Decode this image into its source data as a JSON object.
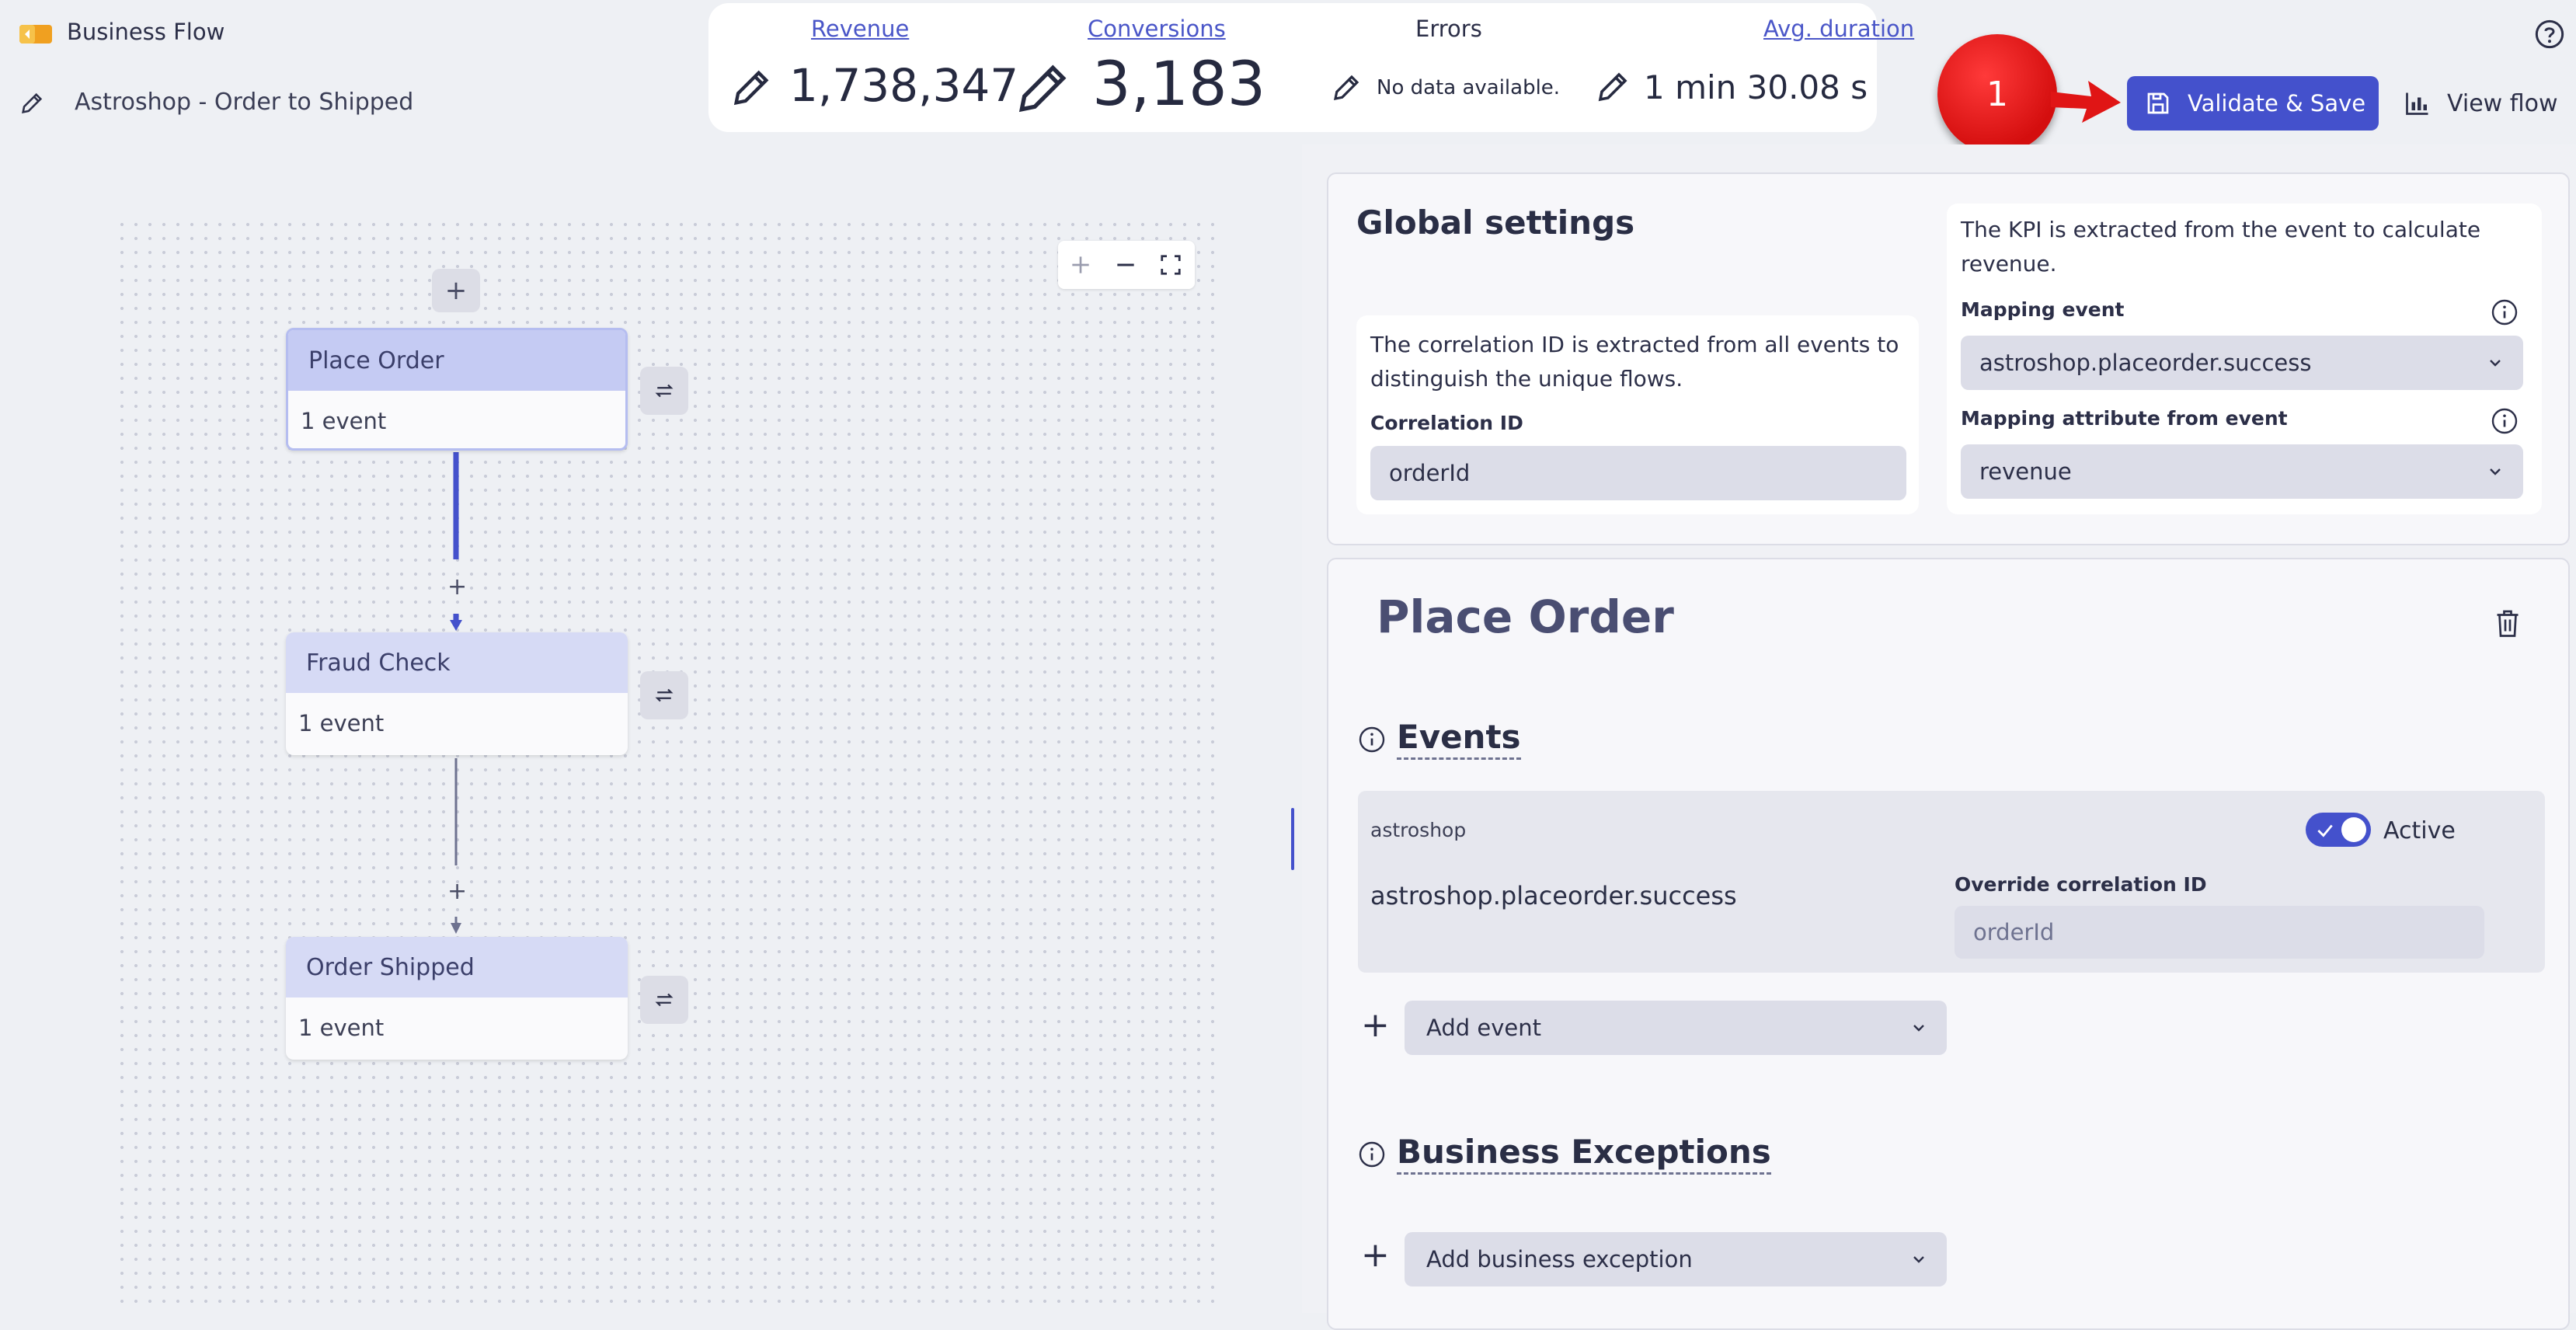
{
  "header": {
    "app_title": "Business Flow",
    "flow_name": "Astroshop - Order to Shipped"
  },
  "kpis": {
    "revenue": {
      "label": "Revenue",
      "value": "1,738,347"
    },
    "conversions": {
      "label": "Conversions",
      "value": "3,183"
    },
    "errors": {
      "label": "Errors",
      "value": "No data available."
    },
    "avg_duration": {
      "label": "Avg. duration",
      "value": "1 min 30.08 s"
    }
  },
  "annotation": {
    "badge_number": "1"
  },
  "toolbar": {
    "validate_save_label": "Validate & Save",
    "view_flow_label": "View flow"
  },
  "canvas": {
    "nodes": [
      {
        "title": "Place Order",
        "subtitle": "1 event",
        "selected": true
      },
      {
        "title": "Fraud Check",
        "subtitle": "1 event",
        "selected": false
      },
      {
        "title": "Order Shipped",
        "subtitle": "1 event",
        "selected": false
      }
    ],
    "connector_plus": "+",
    "add_step": "+"
  },
  "global_settings": {
    "title": "Global settings",
    "correlation_desc": "The correlation ID is extracted from all events to distinguish the unique flows.",
    "correlation_label": "Correlation ID",
    "correlation_value": "orderId",
    "kpi_desc": "The KPI is extracted from the event to calculate revenue.",
    "mapping_event_label": "Mapping event",
    "mapping_event_value": "astroshop.placeorder.success",
    "mapping_attr_label": "Mapping attribute from event",
    "mapping_attr_value": "revenue"
  },
  "step_detail": {
    "title": "Place Order",
    "events_title": "Events",
    "event": {
      "source": "astroshop",
      "name": "astroshop.placeorder.success",
      "active_label": "Active",
      "active": true,
      "override_label": "Override correlation ID",
      "override_placeholder": "orderId"
    },
    "add_event_label": "Add event",
    "business_exceptions_title": "Business Exceptions",
    "add_exception_label": "Add business exception"
  },
  "colors": {
    "accent": "#4451cc",
    "badge_red": "#e01515",
    "node_header": "#d6daf5"
  }
}
